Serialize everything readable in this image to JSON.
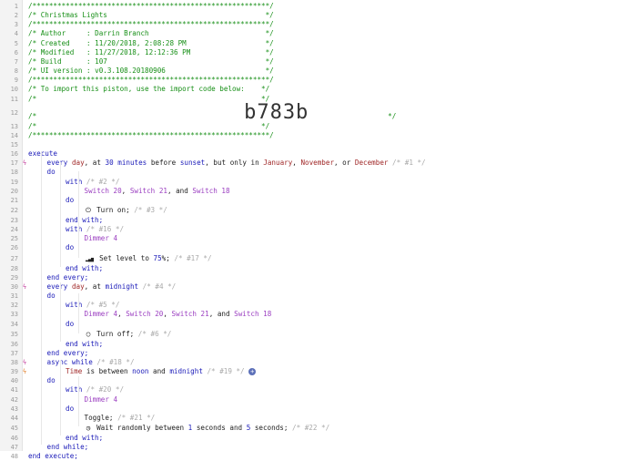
{
  "lines": [
    {
      "n": "1",
      "ind": 0,
      "parts": [
        [
          "g",
          "/*********************************************************/"
        ]
      ]
    },
    {
      "n": "2",
      "ind": 0,
      "parts": [
        [
          "g",
          "/* Christmas Lights                                      */"
        ]
      ]
    },
    {
      "n": "3",
      "ind": 0,
      "parts": [
        [
          "g",
          "/*********************************************************/"
        ]
      ]
    },
    {
      "n": "4",
      "ind": 0,
      "parts": [
        [
          "g",
          "/* Author     : Darrin Branch                            */"
        ]
      ]
    },
    {
      "n": "5",
      "ind": 0,
      "parts": [
        [
          "g",
          "/* Created    : 11/20/2018, 2:08:28 PM                   */"
        ]
      ]
    },
    {
      "n": "6",
      "ind": 0,
      "parts": [
        [
          "g",
          "/* Modified   : 11/27/2018, 12:12:36 PM                  */"
        ]
      ]
    },
    {
      "n": "7",
      "ind": 0,
      "parts": [
        [
          "g",
          "/* Build      : 107                                      */"
        ]
      ]
    },
    {
      "n": "8",
      "ind": 0,
      "parts": [
        [
          "g",
          "/* UI version : v0.3.108.20180906                        */"
        ]
      ]
    },
    {
      "n": "9",
      "ind": 0,
      "parts": [
        [
          "g",
          "/*********************************************************/"
        ]
      ]
    },
    {
      "n": "10",
      "ind": 0,
      "parts": [
        [
          "g",
          "/* To import this piston, use the import code below:    */"
        ]
      ]
    },
    {
      "n": "11",
      "ind": 0,
      "parts": [
        [
          "g",
          "/*                                                      */"
        ]
      ]
    },
    {
      "n": "12",
      "ind": 0,
      "big": true,
      "parts": [
        [
          "g",
          "/*"
        ],
        [
          "big",
          "                b783b"
        ],
        [
          "g",
          "                   */"
        ]
      ]
    },
    {
      "n": "13",
      "ind": 0,
      "parts": [
        [
          "g",
          "/*                                                      */"
        ]
      ]
    },
    {
      "n": "14",
      "ind": 0,
      "parts": [
        [
          "g",
          "/*********************************************************/"
        ]
      ]
    },
    {
      "n": "15",
      "ind": 0,
      "parts": []
    },
    {
      "n": "16",
      "ind": 0,
      "parts": [
        [
          "kw",
          "execute"
        ]
      ]
    },
    {
      "n": "17",
      "ind": 1,
      "mk": "trig",
      "parts": [
        [
          "kw",
          "every "
        ],
        [
          "var",
          "day"
        ],
        [
          "tx",
          ", at "
        ],
        [
          "num",
          "30"
        ],
        [
          "kw",
          " minutes"
        ],
        [
          "tx",
          " before "
        ],
        [
          "kw",
          "sunset"
        ],
        [
          "tx",
          ", but only in "
        ],
        [
          "var",
          "January"
        ],
        [
          "tx",
          ", "
        ],
        [
          "var",
          "November"
        ],
        [
          "tx",
          ", or "
        ],
        [
          "var",
          "December"
        ],
        [
          "cm",
          " /* #1 */"
        ]
      ]
    },
    {
      "n": "18",
      "ind": 1,
      "parts": [
        [
          "kw",
          "do"
        ]
      ]
    },
    {
      "n": "19",
      "ind": 2,
      "parts": [
        [
          "kw",
          "with"
        ],
        [
          "cm",
          " /* #2 */"
        ]
      ]
    },
    {
      "n": "20",
      "ind": 3,
      "parts": [
        [
          "dev",
          "Switch 20"
        ],
        [
          "tx",
          ", "
        ],
        [
          "dev",
          "Switch 21"
        ],
        [
          "tx",
          ", and "
        ],
        [
          "dev",
          "Switch 18"
        ]
      ]
    },
    {
      "n": "21",
      "ind": 2,
      "parts": [
        [
          "kw",
          "do"
        ]
      ]
    },
    {
      "n": "22",
      "ind": 3,
      "icon": "power-icon",
      "glyph": "⏻",
      "parts": [
        [
          "tx",
          "Turn on;"
        ],
        [
          "cm",
          " /* #3 */"
        ]
      ]
    },
    {
      "n": "23",
      "ind": 2,
      "parts": [
        [
          "kw",
          "end with;"
        ]
      ]
    },
    {
      "n": "24",
      "ind": 2,
      "parts": [
        [
          "kw",
          "with"
        ],
        [
          "cm",
          " /* #16 */"
        ]
      ]
    },
    {
      "n": "25",
      "ind": 3,
      "parts": [
        [
          "dev",
          "Dimmer 4"
        ]
      ]
    },
    {
      "n": "26",
      "ind": 2,
      "parts": [
        [
          "kw",
          "do"
        ]
      ]
    },
    {
      "n": "27",
      "ind": 3,
      "icon": "level-bars-icon",
      "glyph": "▂▄▆",
      "parts": [
        [
          "tx",
          "Set level to "
        ],
        [
          "num",
          "75"
        ],
        [
          "tx",
          "%;"
        ],
        [
          "cm",
          " /* #17 */"
        ]
      ]
    },
    {
      "n": "28",
      "ind": 2,
      "parts": [
        [
          "kw",
          "end with;"
        ]
      ]
    },
    {
      "n": "29",
      "ind": 1,
      "parts": [
        [
          "kw",
          "end every;"
        ]
      ]
    },
    {
      "n": "30",
      "ind": 1,
      "mk": "trig",
      "parts": [
        [
          "kw",
          "every "
        ],
        [
          "var",
          "day"
        ],
        [
          "tx",
          ", at "
        ],
        [
          "kw",
          "midnight"
        ],
        [
          "cm",
          " /* #4 */"
        ]
      ]
    },
    {
      "n": "31",
      "ind": 1,
      "parts": [
        [
          "kw",
          "do"
        ]
      ]
    },
    {
      "n": "32",
      "ind": 2,
      "parts": [
        [
          "kw",
          "with"
        ],
        [
          "cm",
          " /* #5 */"
        ]
      ]
    },
    {
      "n": "33",
      "ind": 3,
      "parts": [
        [
          "dev",
          "Dimmer 4"
        ],
        [
          "tx",
          ", "
        ],
        [
          "dev",
          "Switch 20"
        ],
        [
          "tx",
          ", "
        ],
        [
          "dev",
          "Switch 21"
        ],
        [
          "tx",
          ", and "
        ],
        [
          "dev",
          "Switch 18"
        ]
      ]
    },
    {
      "n": "34",
      "ind": 2,
      "parts": [
        [
          "kw",
          "do"
        ]
      ]
    },
    {
      "n": "35",
      "ind": 3,
      "icon": "power-off-icon",
      "glyph": "◯",
      "parts": [
        [
          "tx",
          "Turn off;"
        ],
        [
          "cm",
          " /* #6 */"
        ]
      ]
    },
    {
      "n": "36",
      "ind": 2,
      "parts": [
        [
          "kw",
          "end with;"
        ]
      ]
    },
    {
      "n": "37",
      "ind": 1,
      "parts": [
        [
          "kw",
          "end every;"
        ]
      ]
    },
    {
      "n": "38",
      "ind": 1,
      "mk": "trig",
      "parts": [
        [
          "kw",
          "async while"
        ],
        [
          "cm",
          " /* #18 */"
        ]
      ]
    },
    {
      "n": "39",
      "ind": 2,
      "mk": "cond",
      "plus": true,
      "parts": [
        [
          "var",
          "Time"
        ],
        [
          "tx",
          " is between "
        ],
        [
          "kw",
          "noon"
        ],
        [
          "tx",
          " and "
        ],
        [
          "kw",
          "midnight"
        ],
        [
          "cm",
          " /* #19 */ "
        ]
      ]
    },
    {
      "n": "40",
      "ind": 1,
      "parts": [
        [
          "kw",
          "do"
        ]
      ]
    },
    {
      "n": "41",
      "ind": 2,
      "parts": [
        [
          "kw",
          "with"
        ],
        [
          "cm",
          " /* #20 */"
        ]
      ]
    },
    {
      "n": "42",
      "ind": 3,
      "parts": [
        [
          "dev",
          "Dimmer 4"
        ]
      ]
    },
    {
      "n": "43",
      "ind": 2,
      "parts": [
        [
          "kw",
          "do"
        ]
      ]
    },
    {
      "n": "44",
      "ind": 3,
      "parts": [
        [
          "tx",
          "Toggle;"
        ],
        [
          "cm",
          " /* #21 */"
        ]
      ]
    },
    {
      "n": "45",
      "ind": 3,
      "icon": "clock-icon",
      "glyph": "◷",
      "parts": [
        [
          "tx",
          "Wait randomly between "
        ],
        [
          "num",
          "1"
        ],
        [
          "tx",
          " seconds and "
        ],
        [
          "num",
          "5"
        ],
        [
          "tx",
          " seconds;"
        ],
        [
          "cm",
          " /* #22 */"
        ]
      ]
    },
    {
      "n": "46",
      "ind": 2,
      "parts": [
        [
          "kw",
          "end with;"
        ]
      ]
    },
    {
      "n": "47",
      "ind": 1,
      "parts": [
        [
          "kw",
          "end while;"
        ]
      ]
    },
    {
      "n": "48",
      "ind": 0,
      "parts": [
        [
          "kw",
          "end execute;"
        ]
      ]
    }
  ],
  "markers": {
    "trig": "ϟ",
    "cond": "ϟ"
  },
  "plus_glyph": "+",
  "colors": {
    "comment_header": "#178f17",
    "keyword": "#1a1ab8",
    "variable": "#a02828",
    "device": "#9b3fc1",
    "comment": "#a9a9a9"
  }
}
